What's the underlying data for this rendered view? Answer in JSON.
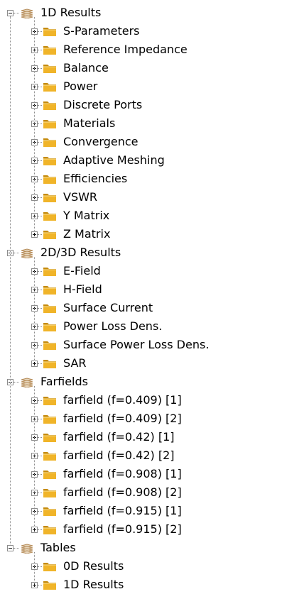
{
  "tree": {
    "groups": [
      {
        "label": "1D Results",
        "expanded": true,
        "icon": "results-stack-icon",
        "children": [
          "S-Parameters",
          "Reference Impedance",
          "Balance",
          "Power",
          "Discrete Ports",
          "Materials",
          "Convergence",
          "Adaptive Meshing",
          "Efficiencies",
          "VSWR",
          "Y Matrix",
          "Z Matrix"
        ]
      },
      {
        "label": "2D/3D Results",
        "expanded": true,
        "icon": "results-stack-icon",
        "children": [
          "E-Field",
          "H-Field",
          "Surface Current",
          "Power Loss Dens.",
          "Surface Power Loss Dens.",
          "SAR"
        ]
      },
      {
        "label": "Farfields",
        "expanded": true,
        "icon": "results-stack-icon",
        "children": [
          "farfield (f=0.409) [1]",
          "farfield (f=0.409) [2]",
          "farfield (f=0.42) [1]",
          "farfield (f=0.42) [2]",
          "farfield (f=0.908) [1]",
          "farfield (f=0.908) [2]",
          "farfield (f=0.915) [1]",
          "farfield (f=0.915) [2]"
        ]
      },
      {
        "label": "Tables",
        "expanded": true,
        "icon": "results-stack-icon",
        "children": [
          "0D Results",
          "1D Results"
        ]
      }
    ]
  },
  "colors": {
    "folder": "#f0b429",
    "folder_dark": "#c58a0c",
    "connector": "#8c8c8c",
    "stack_icon": "#b48a56"
  }
}
